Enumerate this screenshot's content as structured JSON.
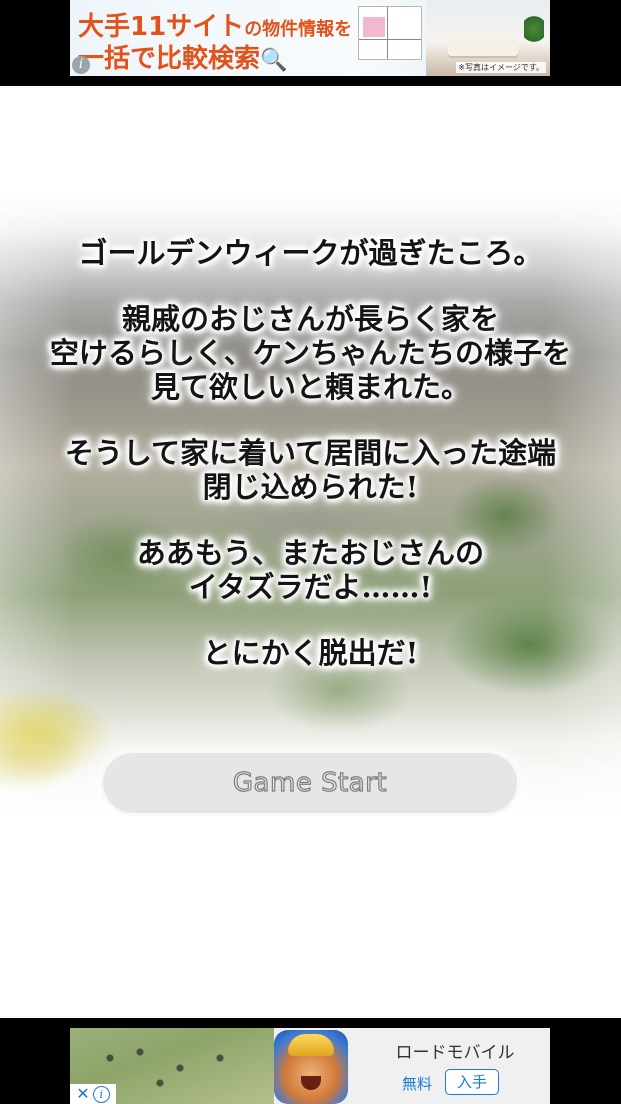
{
  "top_ad": {
    "headline_prefix": "大手11サイト",
    "headline_suffix": "の物件情報を",
    "subline": "一括で比較検索",
    "search_glyph": "🔍",
    "disclaimer": "※写真はイメージです。",
    "info_glyph": "i"
  },
  "story": {
    "paragraphs": [
      [
        "ゴールデンウィークが過ぎたころ。"
      ],
      [
        "親戚のおじさんが長らく家を",
        "空けるらしく、ケンちゃんたちの様子を",
        "見て欲しいと頼まれた。"
      ],
      [
        "そうして家に着いて居間に入った途端",
        "閉じ込められた!"
      ],
      [
        "ああもう、またおじさんの",
        "イタズラだよ……!"
      ],
      [
        "とにかく脱出だ!"
      ]
    ]
  },
  "start_button": {
    "label": "Game Start"
  },
  "bottom_ad": {
    "app_name": "ロードモバイル",
    "price": "無料",
    "install_label": "入手",
    "close_glyph": "✕",
    "info_glyph": "i"
  },
  "colors": {
    "ad_accent": "#e2531c",
    "store_blue": "#1a7ad6"
  }
}
